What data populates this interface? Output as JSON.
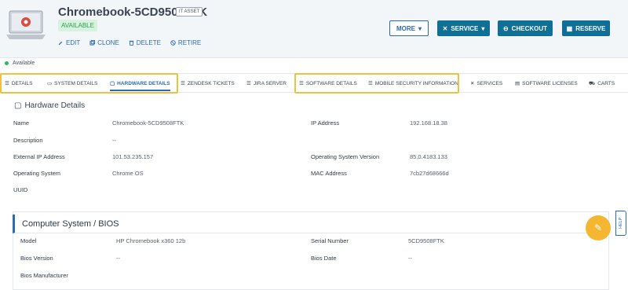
{
  "asset": {
    "title": "Chromebook-5CD9508FTK",
    "tag": "IT ASSET",
    "availability": "AVAILABLE",
    "actions": [
      "EDIT",
      "CLONE",
      "DELETE",
      "RETIRE"
    ]
  },
  "buttons": {
    "more": "MORE",
    "service": "SERVICE",
    "checkout": "CHECKOUT",
    "reserve": "RESERVE"
  },
  "status": "Available",
  "tabs": [
    "DETAILS",
    "SYSTEM DETAILS",
    "HARDWARE DETAILS",
    "ZENDESK TICKETS",
    "JIRA SERVER",
    "SOFTWARE DETAILS",
    "MOBILE SECURITY INFORMATION",
    "SERVICES",
    "SOFTWARE LICENSES",
    "CARTS"
  ],
  "active_tab": "HARDWARE DETAILS",
  "hardware": {
    "title": "Hardware Details",
    "fields": [
      {
        "label": "Name",
        "value": "Chromebook-5CD9508FTK"
      },
      {
        "label": "Description",
        "value": "--"
      },
      {
        "label": "External IP Address",
        "value": "101.53.235.157"
      },
      {
        "label": "Operating System",
        "value": "Chrome OS"
      },
      {
        "label": "UUID",
        "value": ""
      },
      {
        "label": "IP Address",
        "value": "192.168.18.38"
      },
      {
        "label": "Operating System Version",
        "value": "85.0.4183.133"
      },
      {
        "label": "MAC Address",
        "value": "7cb27d68666d"
      }
    ]
  },
  "bios": {
    "title": "Computer System / BIOS",
    "fields": [
      {
        "label": "Model",
        "value": "HP Chromebook x360 12b"
      },
      {
        "label": "Bios Version",
        "value": "--"
      },
      {
        "label": "Bios Manufacturer",
        "value": ""
      },
      {
        "label": "Serial Number",
        "value": "5CD9508FTK"
      },
      {
        "label": "Bios Date",
        "value": "--"
      }
    ]
  },
  "help": "HELP",
  "colors": {
    "accent": "#2a6cb0",
    "primary_button": "#0f6f96",
    "available": "#2e9e4f",
    "highlight": "#f0c040",
    "fab": "#f5b731"
  }
}
